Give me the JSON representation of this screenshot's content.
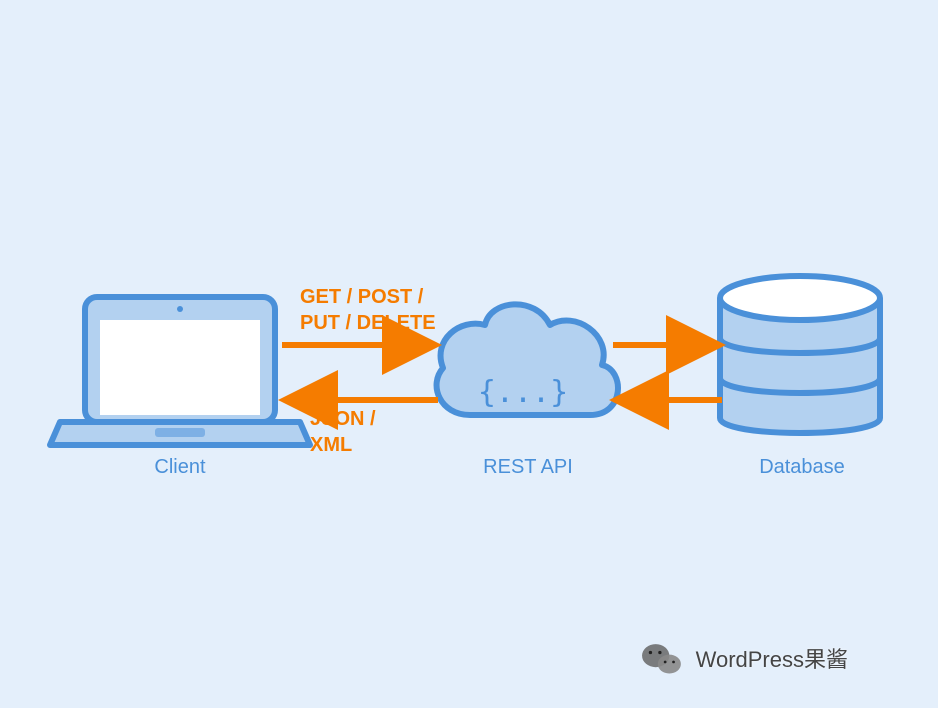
{
  "nodes": {
    "client": {
      "label": "Client"
    },
    "rest_api": {
      "label": "REST API",
      "code": "{...}"
    },
    "database": {
      "label": "Database"
    }
  },
  "arrows": {
    "request_methods": {
      "line1": "GET / POST /",
      "line2": "PUT / DELETE"
    },
    "response_formats": {
      "line1": "JSON /",
      "line2": "XML"
    }
  },
  "watermark": "WordPress果酱",
  "colors": {
    "blue_stroke": "#4a90d9",
    "blue_fill": "#b3d1f0",
    "orange": "#f57c00",
    "background": "#e4effb"
  }
}
